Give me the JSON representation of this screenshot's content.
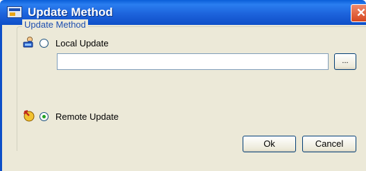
{
  "window": {
    "title": "Update Method",
    "close_glyph": "✕"
  },
  "group": {
    "label": "Update Method"
  },
  "options": {
    "local": {
      "label": "Local Update",
      "checked": false,
      "icon": "user-computer-icon"
    },
    "remote": {
      "label": "Remote Update",
      "checked": true,
      "icon": "remote-update-icon"
    }
  },
  "path": {
    "value": "",
    "placeholder": ""
  },
  "buttons": {
    "browse": "...",
    "ok": "Ok",
    "cancel": "Cancel"
  },
  "colors": {
    "titlebar": "#1d63dc",
    "body": "#ece9d8",
    "group_label": "#1e4fb0",
    "close": "#d6471f"
  }
}
